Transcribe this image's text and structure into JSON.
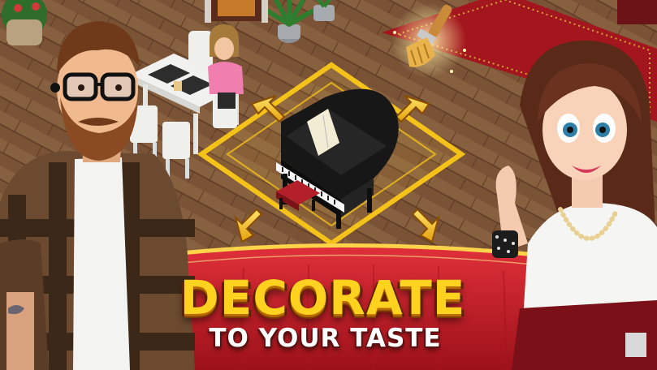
{
  "banner": {
    "title": "DECORATE",
    "subtitle": "TO YOUR TASTE"
  },
  "icons": {
    "move_arrows": [
      "arrow-up-left-icon",
      "arrow-up-right-icon",
      "arrow-down-left-icon",
      "arrow-down-right-icon"
    ],
    "paint_tool": "paintbrush-icon"
  },
  "colors": {
    "title_yellow": "#ffd21f",
    "banner_red": "#c8202a",
    "selection_gold": "#f5c21a",
    "floor_wood": "#7a5236"
  }
}
